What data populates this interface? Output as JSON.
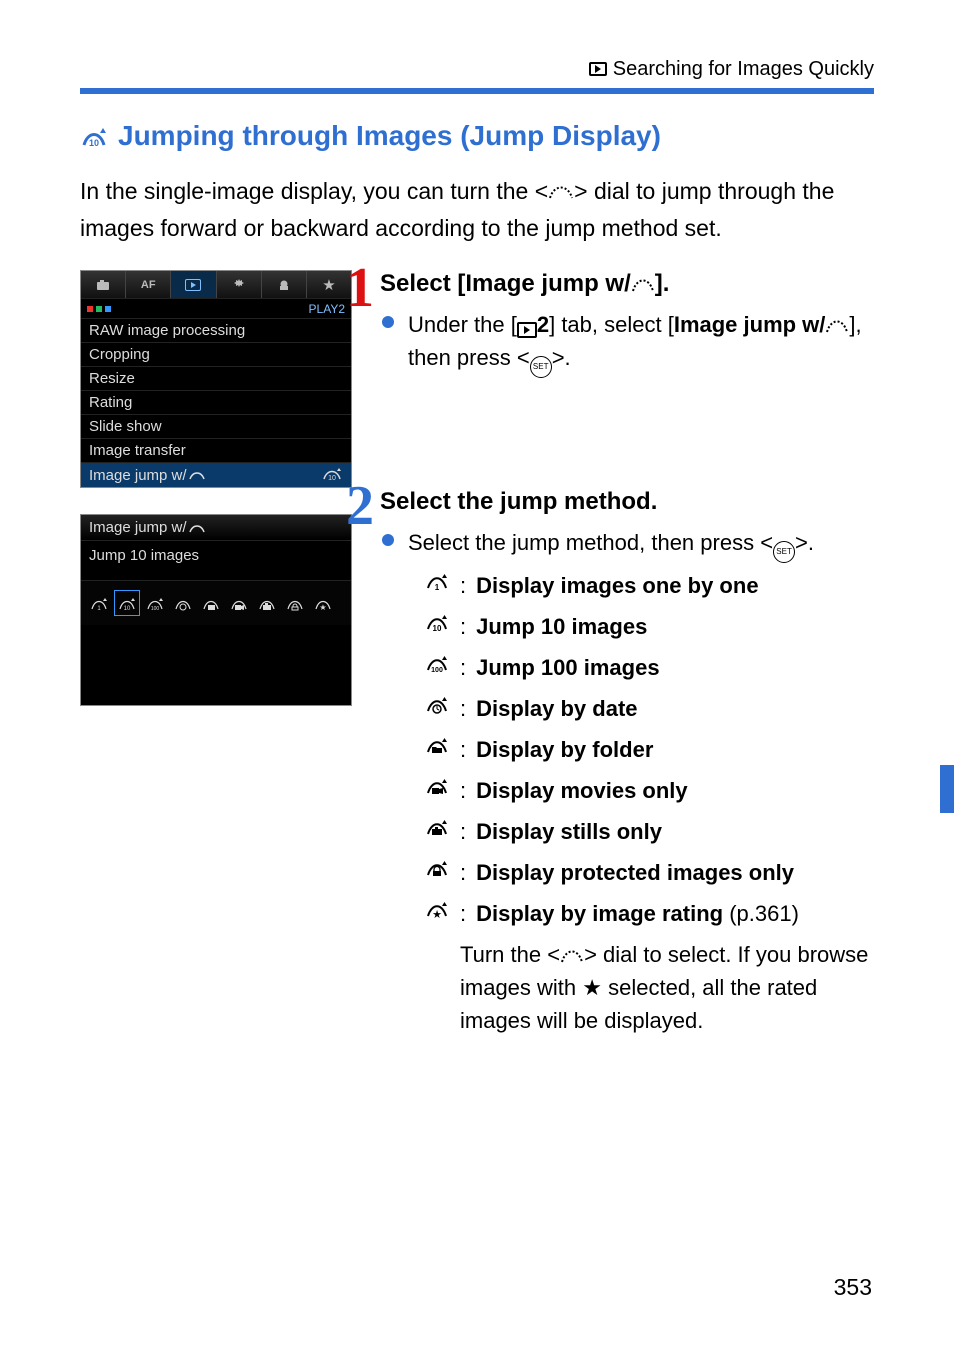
{
  "breadcrumb": "Searching for Images Quickly",
  "heading": "Jumping through Images (Jump Display)",
  "intro_pre": "In the single-image display, you can turn the <",
  "intro_post": "> dial to jump through the images forward or backward according to the jump method set.",
  "step1": {
    "title_pre": "Select [Image jump w/",
    "title_post": "].",
    "body_pre": "Under the [",
    "body_tabnum": "2",
    "body_mid": "] tab, select [",
    "body_bold": "Image jump w/",
    "body_after": "], then press <",
    "body_end": ">."
  },
  "step2": {
    "title": "Select the jump method.",
    "lead_pre": "Select the jump method, then press <",
    "lead_post": ">.",
    "items": [
      "Display images one by one",
      "Jump 10 images",
      "Jump 100 images",
      "Display by date",
      "Display by folder",
      "Display movies only",
      "Display stills only",
      "Display protected images only",
      "Display by image rating"
    ],
    "rating_pageref": " (p.361)",
    "rating_extra_pre": "Turn the <",
    "rating_extra_mid": "> dial to select. If you browse images with ",
    "rating_extra_post": " selected, all the rated images will be displayed."
  },
  "cam_menu": {
    "play_label": "PLAY2",
    "items": [
      "RAW image processing",
      "Cropping",
      "Resize",
      "Rating",
      "Slide show",
      "Image transfer",
      "Image jump w/"
    ]
  },
  "cam_panel2": {
    "title": "Image jump w/",
    "desc": "Jump 10 images"
  },
  "pagenum": "353"
}
